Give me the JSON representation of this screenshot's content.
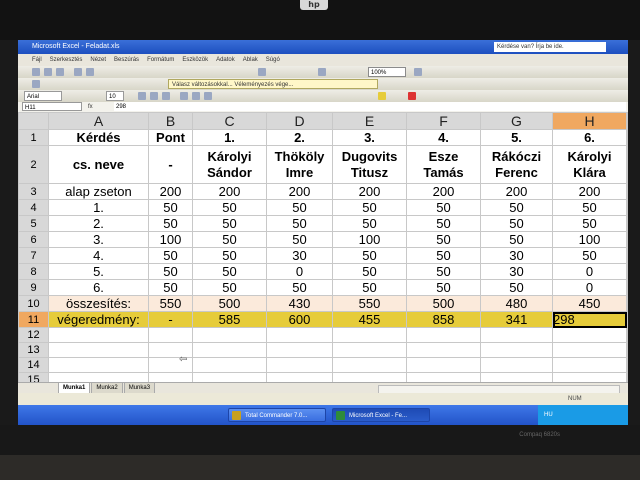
{
  "laptop": {
    "logo": "hp",
    "model": "Compaq 6820s"
  },
  "window": {
    "title": "Microsoft Excel - Feladat.xls",
    "help_placeholder": "Kérdése van? Írja be ide.",
    "menu": [
      "Fájl",
      "Szerkesztés",
      "Nézet",
      "Beszúrás",
      "Formátum",
      "Eszközök",
      "Adatok",
      "Ablak",
      "Súgó"
    ],
    "zoom": "100%",
    "review_text": "Válasz változásokkal... Véleményezés vége...",
    "font_name": "Arial",
    "font_size": "10"
  },
  "formula_bar": {
    "name_box": "H11",
    "fx": "fx",
    "value": "298"
  },
  "columns": [
    "A",
    "B",
    "C",
    "D",
    "E",
    "F",
    "G",
    "H"
  ],
  "active_column": "H",
  "active_row": "11",
  "rows": [
    {
      "num": "1",
      "kind": "header",
      "cells": [
        "Kérdés",
        "Pont",
        "1.",
        "2.",
        "3.",
        "4.",
        "5.",
        "6."
      ]
    },
    {
      "num": "2",
      "kind": "header",
      "cells": [
        "cs. neve",
        "-",
        "Károlyi Sándor",
        "Thököly Imre",
        "Dugovits Titusz",
        "Esze Tamás",
        "Rákóczi Ferenc",
        "Károlyi Klára"
      ]
    },
    {
      "num": "3",
      "kind": "data",
      "cells": [
        "alap zseton",
        "200",
        "200",
        "200",
        "200",
        "200",
        "200",
        "200"
      ]
    },
    {
      "num": "4",
      "kind": "data",
      "cells": [
        "1.",
        "50",
        "50",
        "50",
        "50",
        "50",
        "50",
        "50"
      ]
    },
    {
      "num": "5",
      "kind": "data",
      "cells": [
        "2.",
        "50",
        "50",
        "50",
        "50",
        "50",
        "50",
        "50"
      ]
    },
    {
      "num": "6",
      "kind": "data",
      "cells": [
        "3.",
        "100",
        "50",
        "50",
        "100",
        "50",
        "50",
        "100"
      ]
    },
    {
      "num": "7",
      "kind": "data",
      "cells": [
        "4.",
        "50",
        "50",
        "30",
        "50",
        "50",
        "30",
        "50"
      ]
    },
    {
      "num": "8",
      "kind": "data",
      "cells": [
        "5.",
        "50",
        "50",
        "0",
        "50",
        "50",
        "30",
        "0"
      ]
    },
    {
      "num": "9",
      "kind": "data",
      "cells": [
        "6.",
        "50",
        "50",
        "50",
        "50",
        "50",
        "50",
        "0"
      ]
    },
    {
      "num": "10",
      "kind": "sum",
      "cells": [
        "összesítés:",
        "550",
        "500",
        "430",
        "550",
        "500",
        "480",
        "450"
      ]
    },
    {
      "num": "11",
      "kind": "final",
      "cells": [
        "végeredmény:",
        "-",
        "585",
        "600",
        "455",
        "858",
        "341",
        "298"
      ]
    },
    {
      "num": "12",
      "kind": "empty",
      "cells": [
        "",
        "",
        "",
        "",
        "",
        "",
        "",
        ""
      ]
    },
    {
      "num": "13",
      "kind": "empty",
      "cells": [
        "",
        "",
        "",
        "",
        "",
        "",
        "",
        ""
      ]
    },
    {
      "num": "14",
      "kind": "empty",
      "cells": [
        "",
        "",
        "",
        "",
        "",
        "",
        "",
        ""
      ]
    },
    {
      "num": "15",
      "kind": "empty",
      "cells": [
        "",
        "",
        "",
        "",
        "",
        "",
        "",
        ""
      ]
    },
    {
      "num": "16",
      "kind": "empty",
      "cells": [
        "",
        "",
        "",
        "",
        "",
        "",
        "",
        ""
      ]
    },
    {
      "num": "17",
      "kind": "empty",
      "cells": [
        "",
        "",
        "",
        "",
        "",
        "",
        "",
        ""
      ]
    }
  ],
  "sheet_tabs": [
    "Munka1",
    "Munka2",
    "Munka3"
  ],
  "status": {
    "num": "NUM"
  },
  "taskbar": {
    "tasks": [
      "Total Commander 7.0...",
      "Microsoft Excel - Fe..."
    ],
    "tray_text": "HU"
  },
  "colors": {
    "final_row": "#e6cc3a",
    "sum_row": "#fbeadb",
    "active_header": "#f0a860"
  }
}
